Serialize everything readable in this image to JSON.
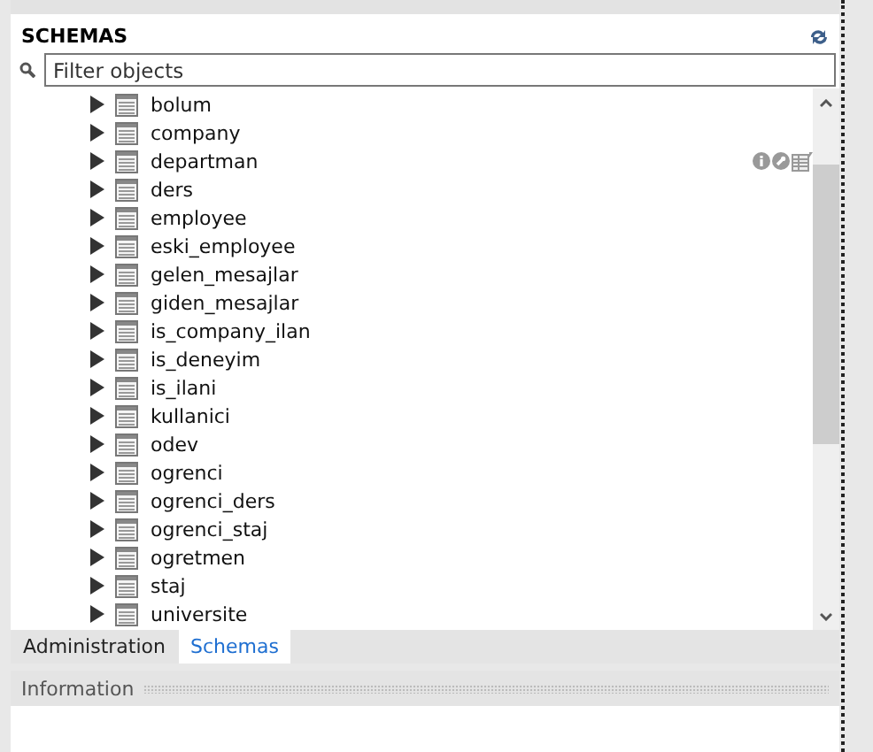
{
  "schemas": {
    "title": "SCHEMAS",
    "filter": {
      "placeholder": "Filter objects"
    },
    "tables": [
      {
        "name": "bolum",
        "expanded": false,
        "hovered": false
      },
      {
        "name": "company",
        "expanded": false,
        "hovered": false
      },
      {
        "name": "departman",
        "expanded": false,
        "hovered": true
      },
      {
        "name": "ders",
        "expanded": false,
        "hovered": false
      },
      {
        "name": "employee",
        "expanded": false,
        "hovered": false
      },
      {
        "name": "eski_employee",
        "expanded": false,
        "hovered": false
      },
      {
        "name": "gelen_mesajlar",
        "expanded": false,
        "hovered": false
      },
      {
        "name": "giden_mesajlar",
        "expanded": false,
        "hovered": false
      },
      {
        "name": "is_company_ilan",
        "expanded": false,
        "hovered": false
      },
      {
        "name": "is_deneyim",
        "expanded": false,
        "hovered": false
      },
      {
        "name": "is_ilani",
        "expanded": false,
        "hovered": false
      },
      {
        "name": "kullanici",
        "expanded": false,
        "hovered": false
      },
      {
        "name": "odev",
        "expanded": false,
        "hovered": false
      },
      {
        "name": "ogrenci",
        "expanded": false,
        "hovered": false
      },
      {
        "name": "ogrenci_ders",
        "expanded": false,
        "hovered": false
      },
      {
        "name": "ogrenci_staj",
        "expanded": false,
        "hovered": false
      },
      {
        "name": "ogretmen",
        "expanded": false,
        "hovered": false
      },
      {
        "name": "staj",
        "expanded": false,
        "hovered": false
      },
      {
        "name": "universite",
        "expanded": false,
        "hovered": false
      }
    ]
  },
  "tabs": [
    {
      "label": "Administration",
      "selected": false
    },
    {
      "label": "Schemas",
      "selected": true
    }
  ],
  "information": {
    "title": "Information"
  }
}
